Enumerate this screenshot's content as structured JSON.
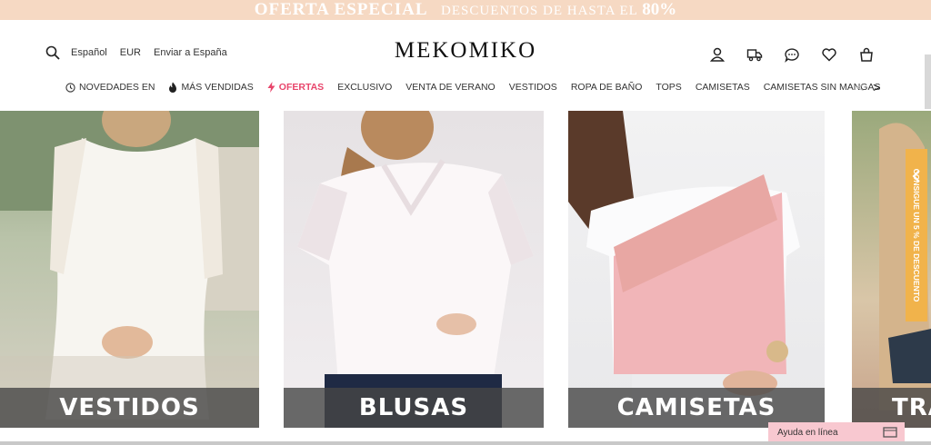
{
  "promo": {
    "headline": "OFERTA ESPECIAL",
    "sub": "DESCUENTOS DE HASTA EL",
    "percent": "80%"
  },
  "header": {
    "language": "Español",
    "currency": "EUR",
    "ship_to": "Enviar a España",
    "logo": "MEKOMIKO",
    "icons": [
      "user-icon",
      "truck-icon",
      "chat-icon",
      "heart-icon",
      "bag-icon"
    ]
  },
  "nav": {
    "items": [
      {
        "label": "NOVEDADES EN",
        "icon": "clock-icon"
      },
      {
        "label": "MÁS VENDIDAS",
        "icon": "flame-icon"
      },
      {
        "label": "OFERTAS",
        "icon": "bolt-icon"
      },
      {
        "label": "EXCLUSIVO"
      },
      {
        "label": "VENTA DE VERANO"
      },
      {
        "label": "VESTIDOS"
      },
      {
        "label": "ROPA DE BAÑO"
      },
      {
        "label": "TOPS"
      },
      {
        "label": "CAMISETAS"
      },
      {
        "label": "CAMISETAS SIN MANGAS"
      }
    ],
    "prev": "<",
    "next": ">"
  },
  "categories": [
    {
      "label": "VESTIDOS"
    },
    {
      "label": "BLUSAS"
    },
    {
      "label": "CAMISETAS"
    },
    {
      "label": "TRA"
    }
  ],
  "side_tab": {
    "text": "CONSIGUE UN 5 % DE DESCUENTO",
    "color": "#f1b34b"
  },
  "help": {
    "label": "Ayuda en línea"
  },
  "colors": {
    "accent": "#e8456b",
    "promo_bg": "#f6d9c3",
    "help_bg": "#f8c8d0"
  }
}
